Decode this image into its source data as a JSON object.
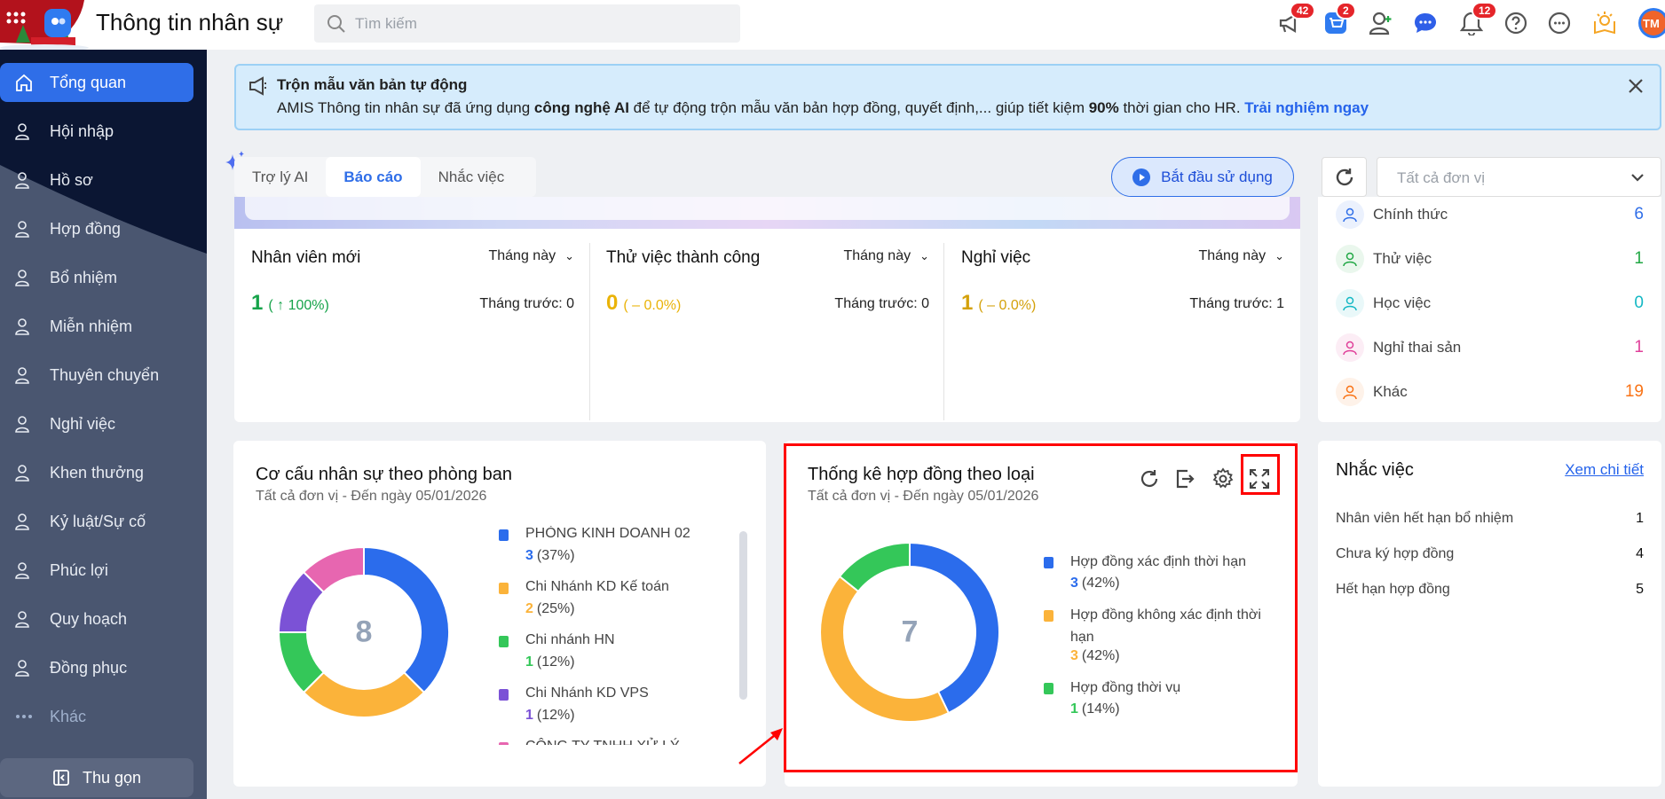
{
  "header": {
    "app_title": "Thông tin nhân sự",
    "search_placeholder": "Tìm kiếm",
    "badges": {
      "announcements": "42",
      "cart": "2",
      "notifications": "12"
    },
    "avatar_initials": "TM"
  },
  "sidebar": {
    "items": [
      {
        "label": "Tổng quan",
        "icon": "home-icon",
        "active": true
      },
      {
        "label": "Hội nhập",
        "icon": "onboarding-icon"
      },
      {
        "label": "Hồ sơ",
        "icon": "profile-icon"
      },
      {
        "label": "Hợp đồng",
        "icon": "contract-icon"
      },
      {
        "label": "Bổ nhiệm",
        "icon": "user-plus-icon"
      },
      {
        "label": "Miễn nhiệm",
        "icon": "user-minus-icon"
      },
      {
        "label": "Thuyên chuyển",
        "icon": "transfer-icon"
      },
      {
        "label": "Nghỉ việc",
        "icon": "user-x-icon"
      },
      {
        "label": "Khen thưởng",
        "icon": "reward-icon"
      },
      {
        "label": "Kỷ luật/Sự cố",
        "icon": "shield-x-icon"
      },
      {
        "label": "Phúc lợi",
        "icon": "benefit-icon"
      },
      {
        "label": "Quy hoạch",
        "icon": "users-icon"
      },
      {
        "label": "Đồng phục",
        "icon": "shirt-icon"
      },
      {
        "label": "Khác",
        "icon": "more-icon"
      }
    ],
    "collapse_label": "Thu gọn"
  },
  "banner": {
    "title": "Trộn mẫu văn bản tự động",
    "text_1": "AMIS Thông tin nhân sự đã ứng dụng ",
    "text_bold_1": "công nghệ AI",
    "text_2": " để tự động trộn mẫu văn bản hợp đồng, quyết định,... giúp tiết kiệm ",
    "text_bold_2": "90%",
    "text_3": " thời gian cho HR. ",
    "cta": "Trải nghiệm ngay"
  },
  "tabs": [
    {
      "label": "Trợ lý AI"
    },
    {
      "label": "Báo cáo",
      "active": true
    },
    {
      "label": "Nhắc việc"
    }
  ],
  "start_button": "Bắt đầu sử dụng",
  "unit_select": "Tất cả đơn vị",
  "stats": [
    {
      "title": "Nhân viên mới",
      "period": "Tháng này",
      "value": "1",
      "change": "( ↑ 100%)",
      "previous": "Tháng trước: 0",
      "color": "#16a34a"
    },
    {
      "title": "Thử việc thành công",
      "period": "Tháng này",
      "value": "0",
      "change": "( – 0.0%)",
      "previous": "Tháng trước: 0",
      "color": "#eab308"
    },
    {
      "title": "Nghỉ việc",
      "period": "Tháng này",
      "value": "1",
      "change": "( – 0.0%)",
      "previous": "Tháng trước: 1",
      "color": "#d4a10a"
    }
  ],
  "status": [
    {
      "label": "Chính thức",
      "value": "6",
      "color": "#2f6ee8"
    },
    {
      "label": "Thử việc",
      "value": "1",
      "color": "#22a845"
    },
    {
      "label": "Học việc",
      "value": "0",
      "color": "#14b8c4"
    },
    {
      "label": "Nghỉ thai sản",
      "value": "1",
      "color": "#e0409a"
    },
    {
      "label": "Khác",
      "value": "19",
      "color": "#f97316"
    }
  ],
  "chart_data": [
    {
      "type": "pie",
      "title": "Cơ cấu nhân sự theo phòng ban",
      "subtitle": "Tất cả đơn vị - Đến ngày 05/01/2026",
      "total": "8",
      "slices": [
        {
          "label": "PHÒNG KINH DOANH 02",
          "value": 3,
          "pct": "(37%)",
          "color": "#2b6cec"
        },
        {
          "label": "Chi Nhánh KD Kế toán",
          "value": 2,
          "pct": "(25%)",
          "color": "#fbb33a"
        },
        {
          "label": "Chi nhánh HN",
          "value": 1,
          "pct": "(12%)",
          "color": "#34c759"
        },
        {
          "label": "Chi Nhánh KD VPS",
          "value": 1,
          "pct": "(12%)",
          "color": "#7b52d6"
        },
        {
          "label": "CÔNG TY TNHH XỬ LÝ",
          "value": 1,
          "pct": "(12%)",
          "color": "#e766b0"
        }
      ]
    },
    {
      "type": "pie",
      "title": "Thống kê hợp đồng theo loại",
      "subtitle": "Tất cả đơn vị - Đến ngày 05/01/2026",
      "total": "7",
      "slices": [
        {
          "label": "Hợp đồng xác định thời hạn",
          "value": 3,
          "pct": "(42%)",
          "color": "#2b6cec"
        },
        {
          "label": "Hợp đồng không xác định thời hạn",
          "value": 3,
          "pct": "(42%)",
          "color": "#fbb33a"
        },
        {
          "label": "Hợp đồng thời vụ",
          "value": 1,
          "pct": "(14%)",
          "color": "#34c759"
        }
      ]
    }
  ],
  "reminders": {
    "title": "Nhắc việc",
    "link": "Xem chi tiết",
    "items": [
      {
        "label": "Nhân viên hết hạn bổ nhiệm",
        "value": "1"
      },
      {
        "label": "Chưa ký hợp đồng",
        "value": "4"
      },
      {
        "label": "Hết hạn hợp đồng",
        "value": "5"
      }
    ]
  }
}
